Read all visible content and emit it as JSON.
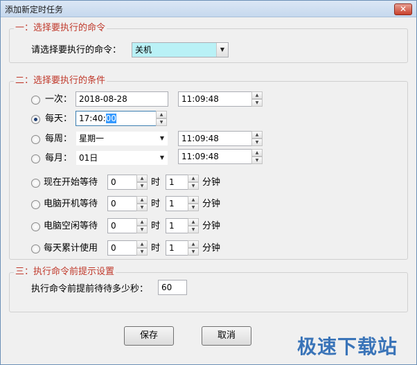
{
  "window": {
    "title": "添加新定时任务",
    "close_glyph": "✕"
  },
  "group1": {
    "title": "一：选择要执行的命令",
    "command_label": "请选择要执行的命令：",
    "command_value": "关机"
  },
  "group2": {
    "title": "二：选择要执行的条件",
    "once": {
      "label": "一次：",
      "date": "2018-08-28",
      "time": "11:09:48"
    },
    "daily": {
      "label": "每天：",
      "time_prefix": "17:40:",
      "time_selected": "00"
    },
    "weekly": {
      "label": "每周：",
      "day": "星期一",
      "time": "11:09:48"
    },
    "monthly": {
      "label": "每月：",
      "day": "01日",
      "time": "11:09:48"
    },
    "wait_rows": [
      {
        "label": "现在开始等待",
        "hours": "0",
        "hour_unit": "时",
        "minutes": "1",
        "minute_unit": "分钟"
      },
      {
        "label": "电脑开机等待",
        "hours": "0",
        "hour_unit": "时",
        "minutes": "1",
        "minute_unit": "分钟"
      },
      {
        "label": "电脑空闲等待",
        "hours": "0",
        "hour_unit": "时",
        "minutes": "1",
        "minute_unit": "分钟"
      },
      {
        "label": "每天累计使用",
        "hours": "0",
        "hour_unit": "时",
        "minutes": "1",
        "minute_unit": "分钟"
      }
    ],
    "selected": "daily"
  },
  "group3": {
    "title": "三：执行命令前提示设置",
    "prompt_label": "执行命令前提前待待多少秒：",
    "prompt_value": "60"
  },
  "buttons": {
    "save": "保存",
    "cancel": "取消"
  },
  "watermark": "极速下载站",
  "colors": {
    "group_title": "#c0392b",
    "highlight_field": "#b9f1f6",
    "watermark": "#3a74b8"
  }
}
